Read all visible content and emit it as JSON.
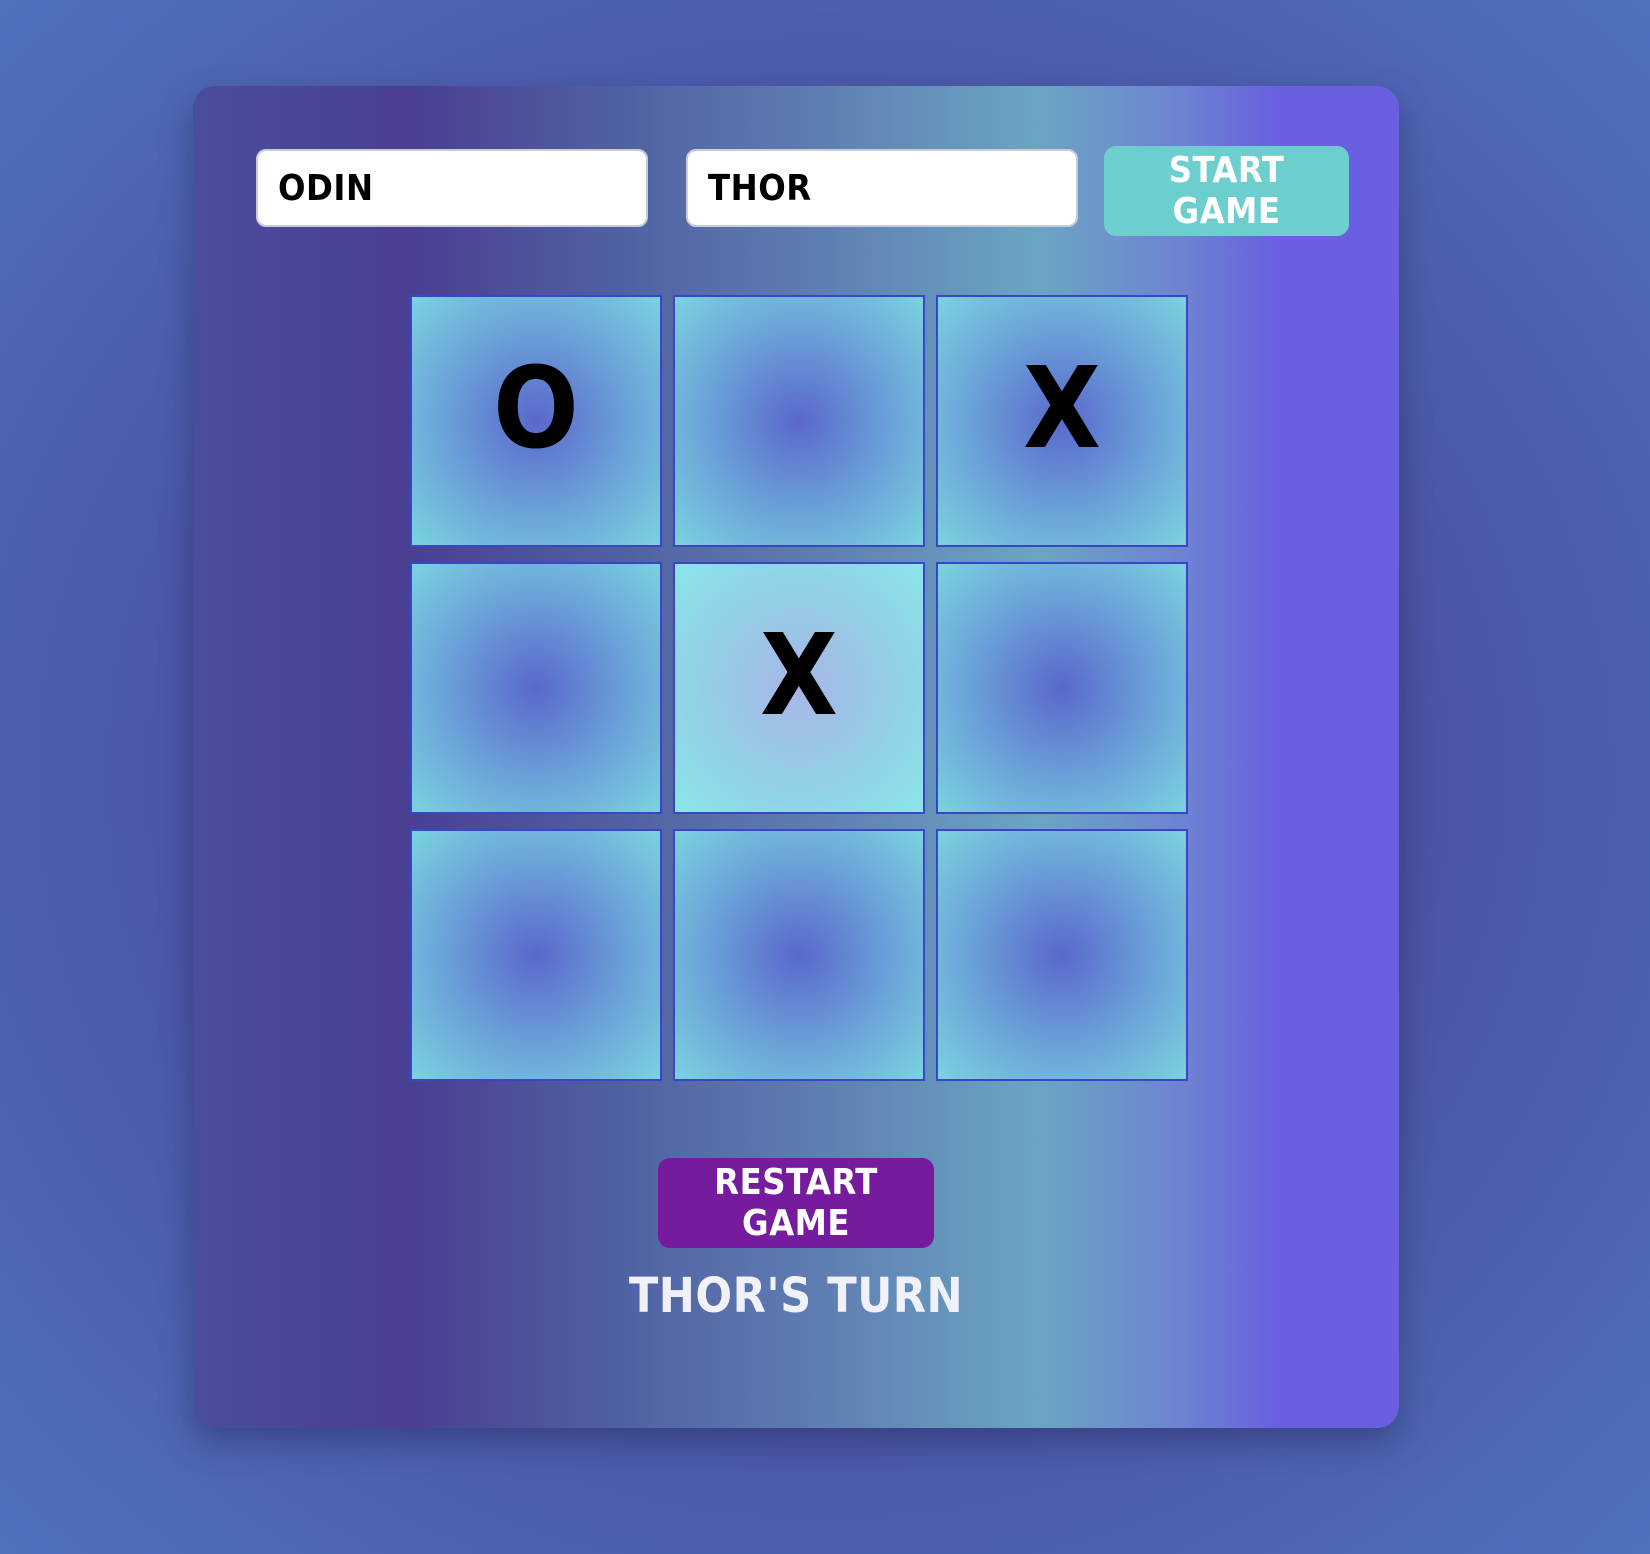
{
  "players": {
    "player1_value": "ODIN",
    "player2_value": "THOR"
  },
  "controls": {
    "start_label": "START GAME",
    "restart_label": "RESTART GAME"
  },
  "board": {
    "cells": [
      "O",
      "",
      "X",
      "",
      "X",
      "",
      "",
      "",
      ""
    ],
    "highlighted_cell": 4
  },
  "status": {
    "text": "THOR'S TURN"
  },
  "colors": {
    "start_button": "#6ccfce",
    "restart_button": "#761b9e",
    "cell_border": "#3b45c8",
    "mark": "#000000"
  }
}
